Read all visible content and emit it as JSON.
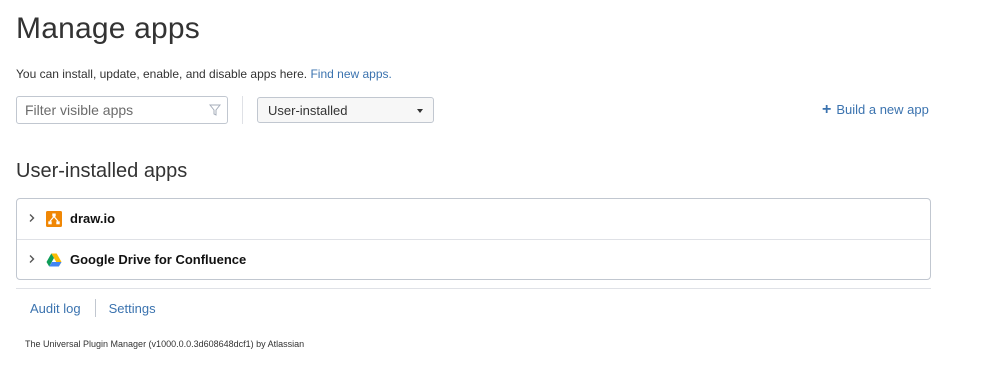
{
  "page": {
    "title": "Manage apps",
    "intro_text": "You can install, update, enable, and disable apps here.",
    "intro_link": "Find new apps."
  },
  "filter": {
    "placeholder": "Filter visible apps",
    "icon": "funnel-icon"
  },
  "view_select": {
    "selected": "User-installed"
  },
  "build_link": {
    "icon": "plus-icon",
    "label": "Build a new app"
  },
  "section": {
    "title": "User-installed apps"
  },
  "apps": [
    {
      "name": "draw.io",
      "icon": "drawio-logo-icon",
      "color": "#f08705"
    },
    {
      "name": "Google Drive for Confluence",
      "icon": "google-drive-logo-icon"
    }
  ],
  "footer": {
    "audit_log": "Audit log",
    "settings": "Settings",
    "copyright": "The Universal Plugin Manager (v1000.0.0.3d608648dcf1) by Atlassian"
  },
  "colors": {
    "link": "#3b73af",
    "text": "#333333",
    "border": "#c1c7d0"
  }
}
